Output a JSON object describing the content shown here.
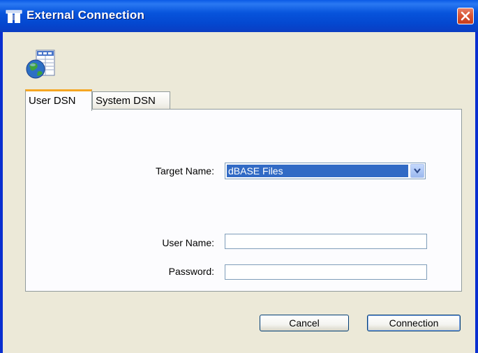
{
  "window": {
    "title": "External Connection"
  },
  "icons": {
    "title": "window-app-icon",
    "app": "database-globe-icon",
    "close": "close-icon",
    "dropdown": "chevron-down-icon"
  },
  "tabs": [
    {
      "label": "User DSN",
      "active": true
    },
    {
      "label": "System DSN",
      "active": false
    }
  ],
  "form": {
    "target_name_label": "Target Name:",
    "target_name_value": "dBASE Files",
    "user_name_label": "User Name:",
    "user_name_value": "",
    "password_label": "Password:",
    "password_value": ""
  },
  "buttons": {
    "cancel": "Cancel",
    "connection": "Connection"
  },
  "colors": {
    "titlebar": "#0754dc",
    "close": "#d95634",
    "tab_highlight": "#f5a623",
    "selection": "#316ac5",
    "dialog_bg": "#ece9d8"
  }
}
